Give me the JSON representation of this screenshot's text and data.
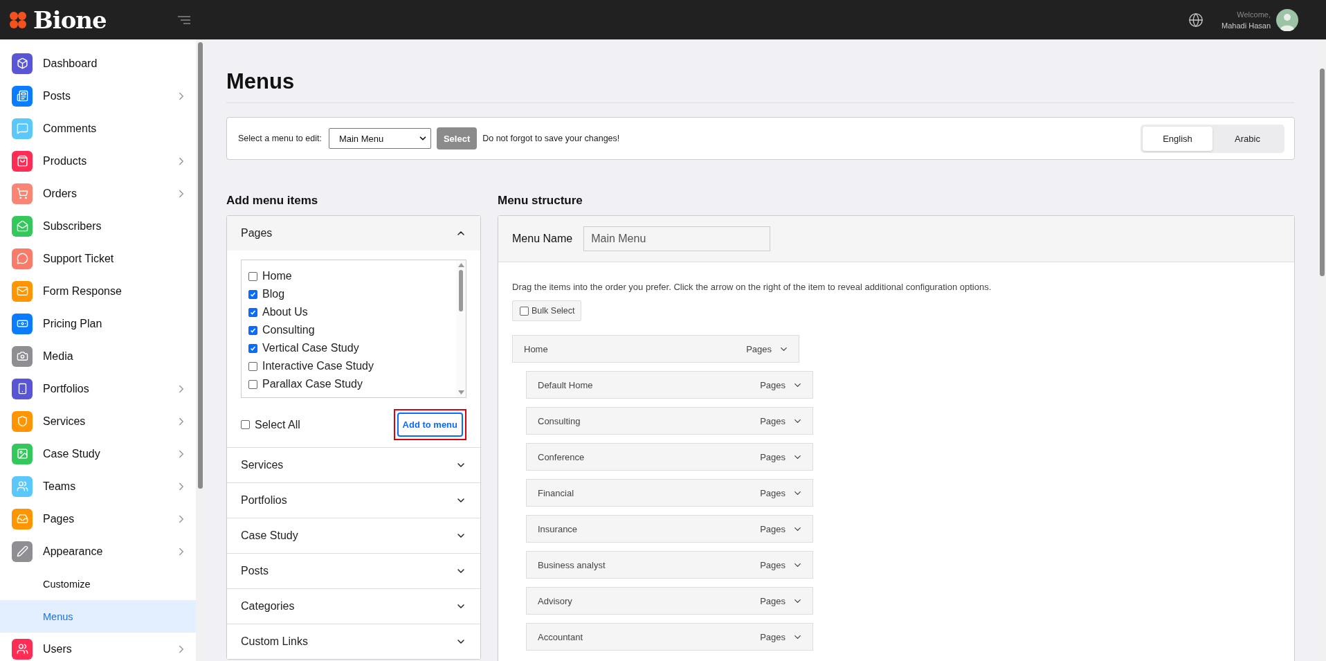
{
  "brand": {
    "name": "Bione"
  },
  "header": {
    "welcome": "Welcome,",
    "user_name": "Mahadi Hasan"
  },
  "sidebar": {
    "items": [
      {
        "label": "Dashboard",
        "color": "#5856d6",
        "has_submenu": false,
        "selected": false
      },
      {
        "label": "Posts",
        "color": "#0a7cff",
        "has_submenu": true,
        "selected": false
      },
      {
        "label": "Comments",
        "color": "#5ac8fa",
        "has_submenu": false,
        "selected": false
      },
      {
        "label": "Products",
        "color": "#ff2d55",
        "has_submenu": true,
        "selected": false
      },
      {
        "label": "Orders",
        "color": "#fb8472",
        "has_submenu": true,
        "selected": false
      },
      {
        "label": "Subscribers",
        "color": "#34c759",
        "has_submenu": false,
        "selected": false
      },
      {
        "label": "Support Ticket",
        "color": "#fb7b6b",
        "has_submenu": false,
        "selected": false
      },
      {
        "label": "Form Response",
        "color": "#ff9500",
        "has_submenu": false,
        "selected": false
      },
      {
        "label": "Pricing Plan",
        "color": "#0a7cff",
        "has_submenu": false,
        "selected": false
      },
      {
        "label": "Media",
        "color": "#8e8e93",
        "has_submenu": false,
        "selected": false
      },
      {
        "label": "Portfolios",
        "color": "#5856d6",
        "has_submenu": true,
        "selected": false
      },
      {
        "label": "Services",
        "color": "#ff9500",
        "has_submenu": true,
        "selected": false
      },
      {
        "label": "Case Study",
        "color": "#34c759",
        "has_submenu": true,
        "selected": false
      },
      {
        "label": "Teams",
        "color": "#5ac8fa",
        "has_submenu": true,
        "selected": false
      },
      {
        "label": "Pages",
        "color": "#ff9500",
        "has_submenu": true,
        "selected": false
      },
      {
        "label": "Appearance",
        "color": "#8e8e93",
        "has_submenu": true,
        "selected": false,
        "children": [
          {
            "label": "Customize",
            "selected": false
          },
          {
            "label": "Menus",
            "selected": true
          }
        ]
      },
      {
        "label": "Users",
        "color": "#ff2d55",
        "has_submenu": true,
        "selected": false
      }
    ]
  },
  "page_title": "Menus",
  "menu_picker": {
    "label": "Select a menu to edit:",
    "value": "Main Menu",
    "button": "Select",
    "note": "Do not forgot to save your changes!",
    "languages": [
      {
        "label": "English",
        "selected": true
      },
      {
        "label": "Arabic",
        "selected": false
      }
    ]
  },
  "add_menu_items": {
    "title": "Add menu items",
    "sections": [
      {
        "title": "Pages",
        "expanded": true,
        "pages": [
          {
            "label": "Home",
            "checked": false
          },
          {
            "label": "Blog",
            "checked": true
          },
          {
            "label": "About Us",
            "checked": true
          },
          {
            "label": "Consulting",
            "checked": true
          },
          {
            "label": "Vertical Case Study",
            "checked": true
          },
          {
            "label": "Interactive Case Study",
            "checked": false
          },
          {
            "label": "Parallax Case Study",
            "checked": false
          }
        ],
        "select_all": {
          "label": "Select All",
          "checked": false
        },
        "add_button": {
          "label": "Add to menu",
          "highlighted": true
        }
      },
      {
        "title": "Services",
        "expanded": false
      },
      {
        "title": "Portfolios",
        "expanded": false
      },
      {
        "title": "Case Study",
        "expanded": false
      },
      {
        "title": "Posts",
        "expanded": false
      },
      {
        "title": "Categories",
        "expanded": false
      },
      {
        "title": "Custom Links",
        "expanded": false
      }
    ]
  },
  "menu_structure": {
    "title": "Menu structure",
    "menu_name_label": "Menu Name",
    "menu_name": "Main Menu",
    "instructions": "Drag the items into the order you prefer. Click the arrow on the right of the item to reveal additional configuration options.",
    "bulk_select": {
      "label": "Bulk Select",
      "checked": false
    },
    "items": [
      {
        "label": "Home",
        "type": "Pages",
        "children": [
          {
            "label": "Default Home",
            "type": "Pages"
          },
          {
            "label": "Consulting",
            "type": "Pages"
          },
          {
            "label": "Conference",
            "type": "Pages"
          },
          {
            "label": "Financial",
            "type": "Pages"
          },
          {
            "label": "Insurance",
            "type": "Pages"
          },
          {
            "label": "Business analyst",
            "type": "Pages"
          },
          {
            "label": "Advisory",
            "type": "Pages"
          },
          {
            "label": "Accountant",
            "type": "Pages"
          }
        ]
      }
    ]
  }
}
